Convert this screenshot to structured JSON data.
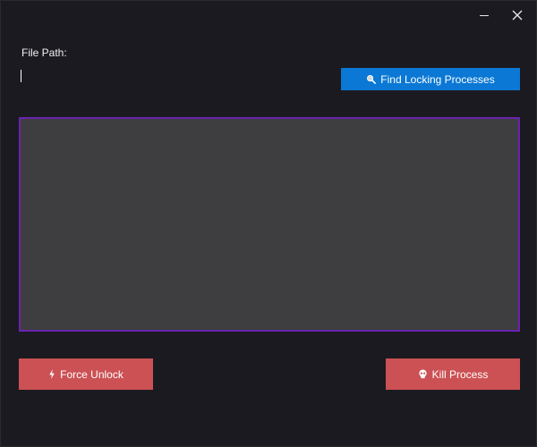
{
  "titlebar": {
    "minimize_icon": "minimize-icon",
    "close_icon": "close-icon"
  },
  "file_path": {
    "label": "File Path:",
    "value": "",
    "placeholder": ""
  },
  "find_button": {
    "icon": "magnifier-icon",
    "label": "Find Locking Processes",
    "color": "#0a78d4"
  },
  "results_panel": {
    "background": "#3e3e40",
    "border_color": "#6a22b0"
  },
  "force_unlock_button": {
    "icon": "lightning-icon",
    "label": "Force Unlock",
    "color": "#cc5154"
  },
  "kill_process_button": {
    "icon": "skull-icon",
    "label": "Kill Process",
    "color": "#cc5154"
  }
}
